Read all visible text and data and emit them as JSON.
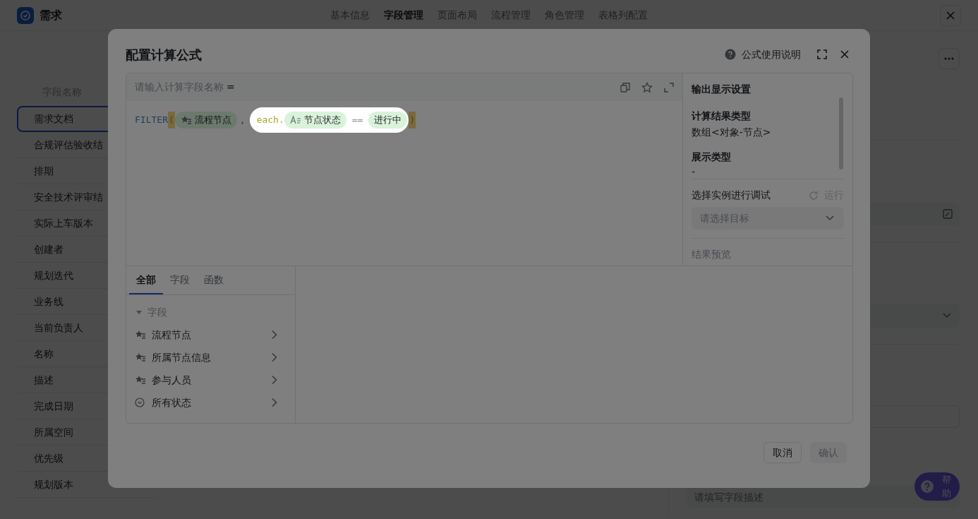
{
  "app": {
    "title": "需求"
  },
  "nav_tabs": [
    {
      "label": "基本信息",
      "selected": false
    },
    {
      "label": "字段管理",
      "selected": true
    },
    {
      "label": "页面布局",
      "selected": false
    },
    {
      "label": "流程管理",
      "selected": false
    },
    {
      "label": "角色管理",
      "selected": false
    },
    {
      "label": "表格列配置",
      "selected": false
    }
  ],
  "field_list": {
    "header": "字段名称",
    "items": [
      {
        "label": "需求文档",
        "selected": true
      },
      {
        "label": "合规评估验收结",
        "selected": false
      },
      {
        "label": "排期",
        "selected": false
      },
      {
        "label": "安全技术评审结",
        "selected": false
      },
      {
        "label": "实际上车版本",
        "selected": false
      },
      {
        "label": "创建者",
        "selected": false
      },
      {
        "label": "规划迭代",
        "selected": false
      },
      {
        "label": "业务线",
        "selected": false
      },
      {
        "label": "当前负责人",
        "selected": false
      },
      {
        "label": "名称",
        "selected": false
      },
      {
        "label": "描述",
        "selected": false
      },
      {
        "label": "完成日期",
        "selected": false
      },
      {
        "label": "所属空间",
        "selected": false
      },
      {
        "label": "优先级",
        "selected": false
      },
      {
        "label": "规划版本",
        "selected": false
      }
    ]
  },
  "detail_panel": {
    "description_placeholder": "请填写字段描述"
  },
  "help_button": "帮助",
  "dialog": {
    "title": "配置计算公式",
    "help_link": "公式使用说明",
    "name_placeholder": "请输入计算字段名称",
    "name_suffix": "=",
    "formula": [
      {
        "kind": "function",
        "text": "FILTER"
      },
      {
        "kind": "paren",
        "text": "("
      },
      {
        "kind": "list_field",
        "text": "流程节点"
      },
      {
        "kind": "separator",
        "text": ","
      },
      {
        "kind": "spotlight",
        "tokens": [
          {
            "kind": "keyword",
            "text": "each."
          },
          {
            "kind": "text_field",
            "text": "节点状态"
          },
          {
            "kind": "operator",
            "text": "=="
          },
          {
            "kind": "value",
            "text": "进行中"
          }
        ]
      },
      {
        "kind": "paren",
        "text": ")"
      }
    ],
    "output": {
      "title": "输出显示设置",
      "result_type_label": "计算结果类型",
      "result_type": "数组<对象-节点>",
      "display_type_label": "展示类型",
      "display_type": "-",
      "debug_label": "选择实例进行调试",
      "run_label": "运行",
      "run_disabled": true,
      "target_placeholder": "请选择目标",
      "preview_label": "结果预览"
    },
    "tabs": [
      {
        "label": "全部",
        "selected": true
      },
      {
        "label": "字段",
        "selected": false
      },
      {
        "label": "函数",
        "selected": false
      }
    ],
    "tree": [
      {
        "label": "字段",
        "expanded": true,
        "children": [
          {
            "label": "流程节点",
            "kind": "list"
          },
          {
            "label": "所属节点信息",
            "kind": "list"
          },
          {
            "label": "参与人员",
            "kind": "list"
          },
          {
            "label": "所有状态",
            "kind": "status"
          }
        ]
      }
    ],
    "buttons": [
      {
        "label": "取消",
        "kind": "secondary",
        "disabled": false
      },
      {
        "label": "确认",
        "kind": "primary",
        "disabled": true
      }
    ]
  }
}
